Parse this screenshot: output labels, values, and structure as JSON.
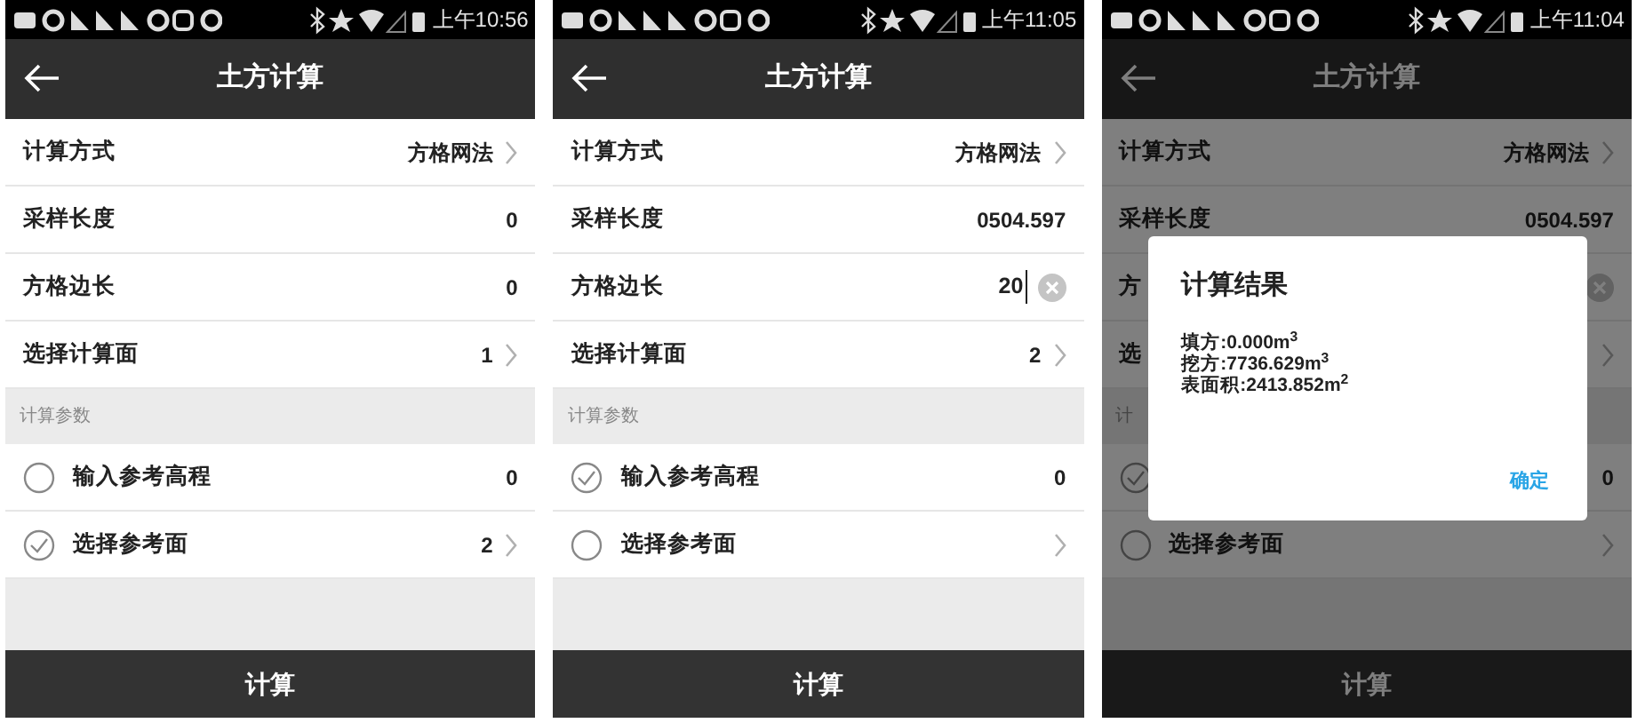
{
  "screens": [
    {
      "status_time": "上午10:56",
      "title": "土方计算",
      "rows": [
        {
          "kind": "nav",
          "label": "计算方式",
          "value": "方格网法"
        },
        {
          "kind": "value",
          "label": "采样长度",
          "value": "0"
        },
        {
          "kind": "value",
          "label": "方格边长",
          "value": "0"
        },
        {
          "kind": "nav",
          "label": "选择计算面",
          "value": "1"
        }
      ],
      "section_header": "计算参数",
      "params": [
        {
          "kind": "value",
          "label": "输入参考高程",
          "value": "0",
          "checked": false
        },
        {
          "kind": "nav",
          "label": "选择参考面",
          "value": "2",
          "checked": true
        }
      ],
      "button": "计算"
    },
    {
      "status_time": "上午11:05",
      "title": "土方计算",
      "rows": [
        {
          "kind": "nav",
          "label": "计算方式",
          "value": "方格网法"
        },
        {
          "kind": "value",
          "label": "采样长度",
          "value": "0504.597"
        },
        {
          "kind": "input",
          "label": "方格边长",
          "value": "20"
        },
        {
          "kind": "nav",
          "label": "选择计算面",
          "value": "2"
        }
      ],
      "section_header": "计算参数",
      "params": [
        {
          "kind": "value",
          "label": "输入参考高程",
          "value": "0",
          "checked": true
        },
        {
          "kind": "nav",
          "label": "选择参考面",
          "checked": false
        }
      ],
      "button": "计算"
    },
    {
      "status_time": "上午11:04",
      "title": "土方计算",
      "rows": [
        {
          "kind": "nav",
          "label": "计算方式",
          "value": "方格网法"
        },
        {
          "kind": "value",
          "label": "采样长度",
          "value": "0504.597"
        },
        {
          "kind": "input",
          "label": "方"
        },
        {
          "kind": "nav",
          "label": "选"
        }
      ],
      "section_header": "计",
      "params": [
        {
          "kind": "value",
          "value": "0",
          "checked": true
        },
        {
          "kind": "nav",
          "label": "选择参考面",
          "checked": false
        }
      ],
      "button": "计算",
      "dialog": {
        "title": "计算结果",
        "lines": [
          "填方:0.000m$^{3}$",
          "挖方:7736.629m$^{3}$",
          "表面积:2413.852m$^{2}$"
        ],
        "ok": "确定"
      }
    }
  ]
}
